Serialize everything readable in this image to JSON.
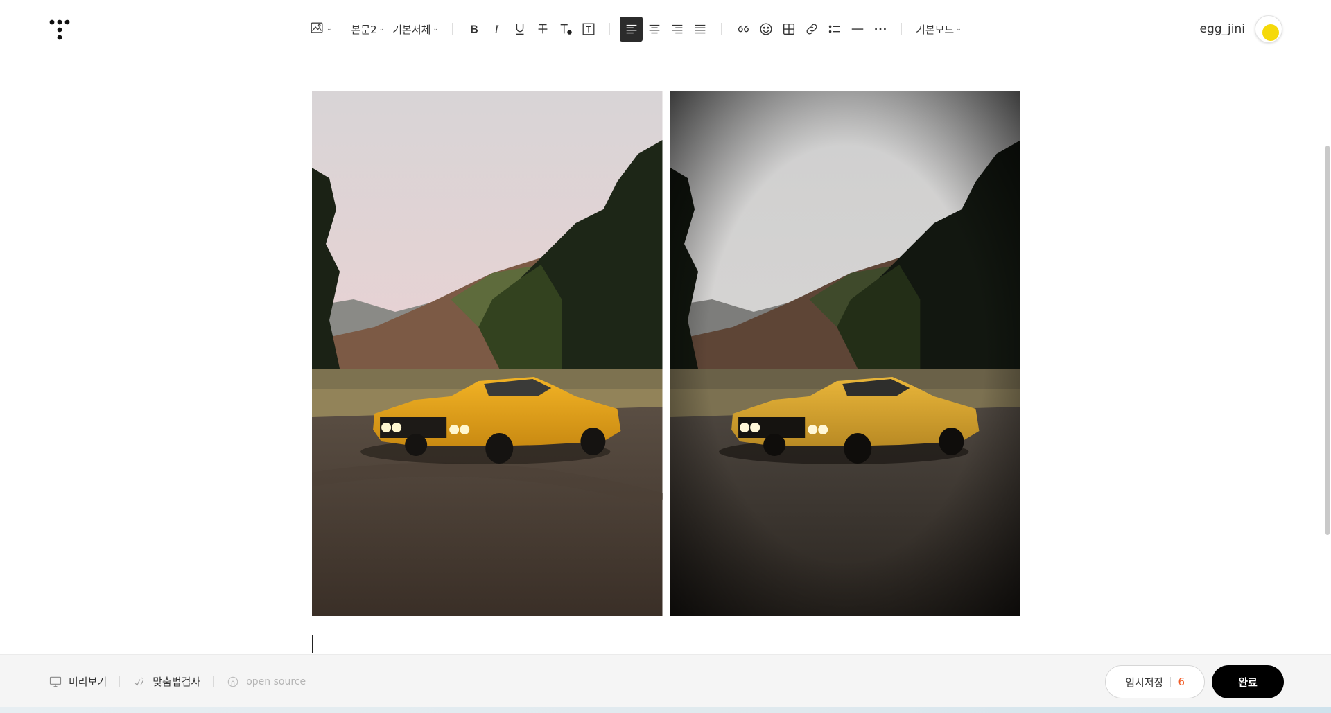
{
  "toolbar": {
    "paragraph_style": "본문2",
    "font_family": "기본서체",
    "mode": "기본모드",
    "buttons": [
      "image",
      "bold",
      "italic",
      "underline",
      "strikethrough",
      "text-color",
      "text-background",
      "align-left",
      "align-center",
      "align-right",
      "align-justify",
      "quote",
      "emoticon",
      "table",
      "link",
      "list",
      "divider",
      "more"
    ],
    "active_button": "align-left"
  },
  "user": {
    "name": "egg_jini",
    "avatar_color": "#f5d90a"
  },
  "editor": {
    "images": [
      {
        "name": "yellow-car-original",
        "filter": "none"
      },
      {
        "name": "yellow-car-vignette",
        "filter": "vignette"
      }
    ]
  },
  "bottom": {
    "preview_label": "미리보기",
    "spellcheck_label": "맞춤법검사",
    "opensource_label": "open source",
    "save_label": "임시저장",
    "save_count": "6",
    "done_label": "완료",
    "accent_color": "#f15a24"
  }
}
